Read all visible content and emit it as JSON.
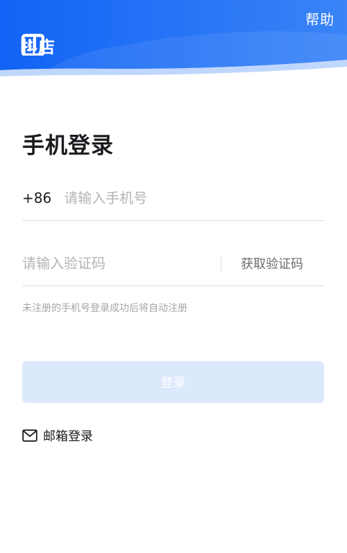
{
  "header": {
    "help_label": "帮助",
    "brand_name": "抖店",
    "colors": {
      "gradient_start": "#1464f6",
      "gradient_end": "#3d86f8"
    }
  },
  "login": {
    "title": "手机登录",
    "phone": {
      "country_code": "+86",
      "placeholder": "请输入手机号",
      "value": ""
    },
    "code": {
      "placeholder": "请输入验证码",
      "value": "",
      "get_code_label": "获取验证码"
    },
    "hint": "未注册的手机号登录成功后将自动注册",
    "submit_label": "登录",
    "submit_enabled": false,
    "alt_login_label": "邮箱登录",
    "alt_login_icon": "mail-icon"
  }
}
